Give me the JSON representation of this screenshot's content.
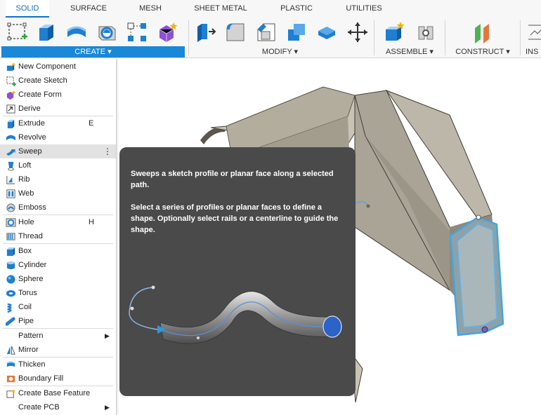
{
  "toolbar": {
    "tabs": [
      {
        "label": "SOLID",
        "active": true
      },
      {
        "label": "SURFACE",
        "active": false
      },
      {
        "label": "MESH",
        "active": false
      },
      {
        "label": "SHEET METAL",
        "active": false
      },
      {
        "label": "PLASTIC",
        "active": false
      },
      {
        "label": "UTILITIES",
        "active": false
      }
    ],
    "groups": {
      "create": "CREATE ▾",
      "modify": "MODIFY ▾",
      "assemble": "ASSEMBLE ▾",
      "construct": "CONSTRUCT ▾",
      "inspect": "INS"
    },
    "icons": [
      "create-sketch-icon",
      "extrude-icon",
      "revolve-icon",
      "hole-icon",
      "pattern-icon",
      "create-form-icon",
      "press-pull-icon",
      "fillet-icon",
      "chamfer-icon",
      "combine-icon",
      "shell-icon",
      "move-icon",
      "new-component-icon",
      "joint-icon",
      "offset-plane-icon"
    ],
    "accent_color": "#1a87d7"
  },
  "create_menu": {
    "items": [
      {
        "label": "New Component",
        "icon": "new-component-icon"
      },
      {
        "label": "Create Sketch",
        "icon": "create-sketch-icon"
      },
      {
        "label": "Create Form",
        "icon": "create-form-icon"
      },
      {
        "label": "Derive",
        "icon": "derive-icon"
      },
      {
        "label": "Extrude",
        "icon": "extrude-icon",
        "shortcut": "E"
      },
      {
        "label": "Revolve",
        "icon": "revolve-icon"
      },
      {
        "label": "Sweep",
        "icon": "sweep-icon",
        "highlighted": true,
        "more": "⋮"
      },
      {
        "label": "Loft",
        "icon": "loft-icon"
      },
      {
        "label": "Rib",
        "icon": "rib-icon"
      },
      {
        "label": "Web",
        "icon": "web-icon"
      },
      {
        "label": "Emboss",
        "icon": "emboss-icon"
      },
      {
        "label": "Hole",
        "icon": "hole-icon",
        "shortcut": "H"
      },
      {
        "label": "Thread",
        "icon": "thread-icon"
      },
      {
        "label": "Box",
        "icon": "box-icon"
      },
      {
        "label": "Cylinder",
        "icon": "cylinder-icon"
      },
      {
        "label": "Sphere",
        "icon": "sphere-icon"
      },
      {
        "label": "Torus",
        "icon": "torus-icon"
      },
      {
        "label": "Coil",
        "icon": "coil-icon"
      },
      {
        "label": "Pipe",
        "icon": "pipe-icon"
      },
      {
        "label": "Pattern",
        "icon": "none",
        "submenu": "▶"
      },
      {
        "label": "Mirror",
        "icon": "mirror-icon"
      },
      {
        "label": "Thicken",
        "icon": "thicken-icon"
      },
      {
        "label": "Boundary Fill",
        "icon": "boundary-fill-icon"
      },
      {
        "label": "Create Base Feature",
        "icon": "base-feature-icon"
      },
      {
        "label": "Create PCB",
        "icon": "none",
        "submenu": "▶"
      }
    ]
  },
  "tooltip": {
    "line1": "Sweeps a sketch profile or planar face along a selected path.",
    "line2": "Select a series of profiles or planar faces to define a shape. Optionally select rails or a centerline to guide the shape."
  }
}
